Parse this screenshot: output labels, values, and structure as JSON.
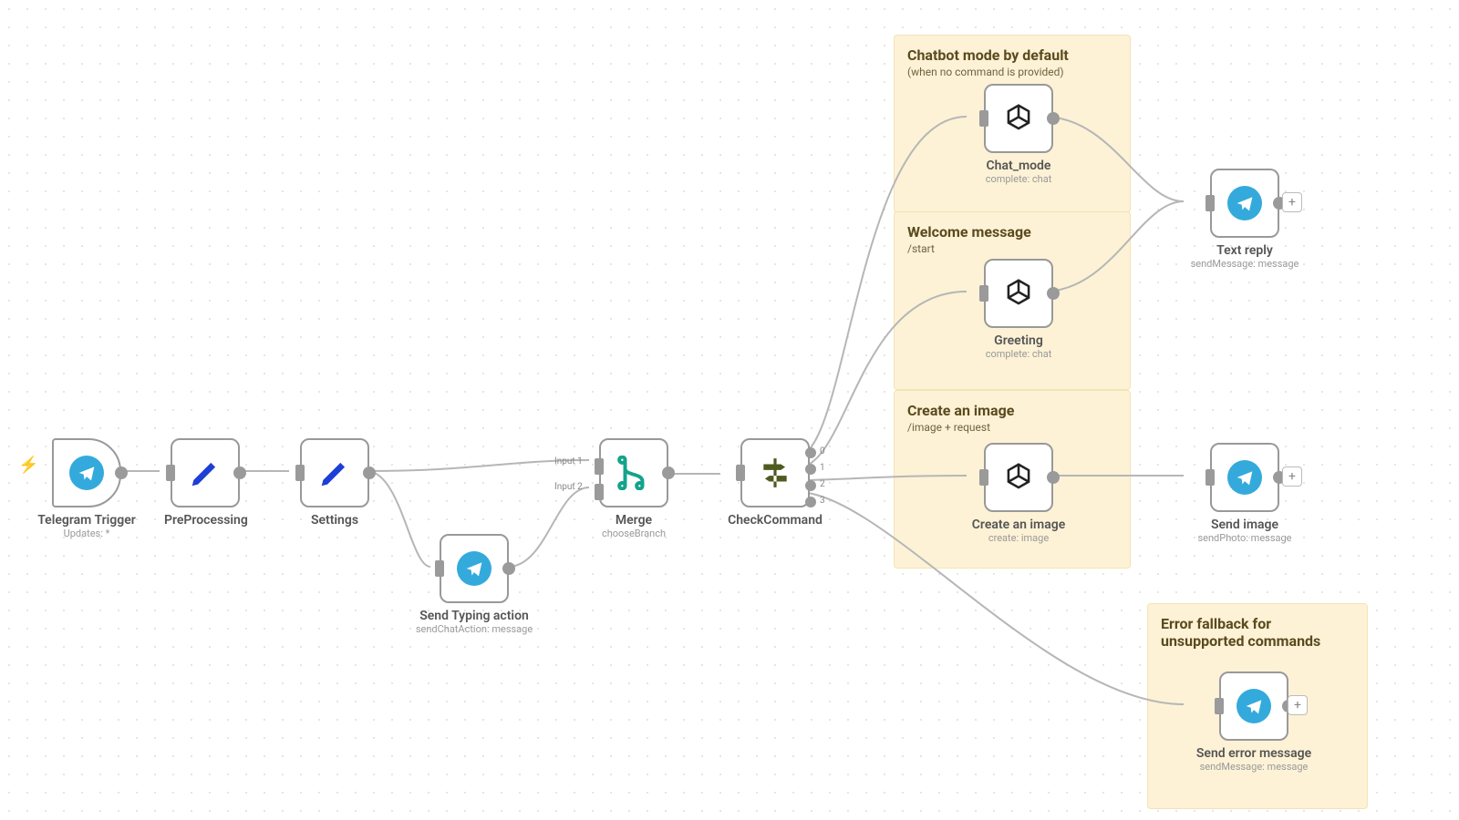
{
  "stickies": {
    "chatmode": {
      "title": "Chatbot mode by default",
      "sub": "(when no command is provided)"
    },
    "welcome": {
      "title": "Welcome message",
      "sub": "/start"
    },
    "image": {
      "title": "Create an image",
      "sub": "/image + request"
    },
    "error": {
      "title": "Error fallback for unsupported commands",
      "sub": ""
    }
  },
  "nodes": {
    "trigger": {
      "title": "Telegram Trigger",
      "sub": "Updates: *"
    },
    "preproc": {
      "title": "PreProcessing",
      "sub": ""
    },
    "settings": {
      "title": "Settings",
      "sub": ""
    },
    "typing": {
      "title": "Send Typing action",
      "sub": "sendChatAction: message"
    },
    "merge": {
      "title": "Merge",
      "sub": "chooseBranch",
      "in1": "Input 1",
      "in2": "Input 2"
    },
    "check": {
      "title": "CheckCommand",
      "sub": "",
      "o0": "0",
      "o1": "1",
      "o2": "2",
      "o3": "3"
    },
    "chat": {
      "title": "Chat_mode",
      "sub": "complete: chat"
    },
    "greeting": {
      "title": "Greeting",
      "sub": "complete: chat"
    },
    "createimg": {
      "title": "Create an image",
      "sub": "create: image"
    },
    "textreply": {
      "title": "Text reply",
      "sub": "sendMessage: message"
    },
    "sendimage": {
      "title": "Send image",
      "sub": "sendPhoto: message"
    },
    "senderr": {
      "title": "Send error message",
      "sub": "sendMessage: message"
    }
  },
  "plus": "+"
}
